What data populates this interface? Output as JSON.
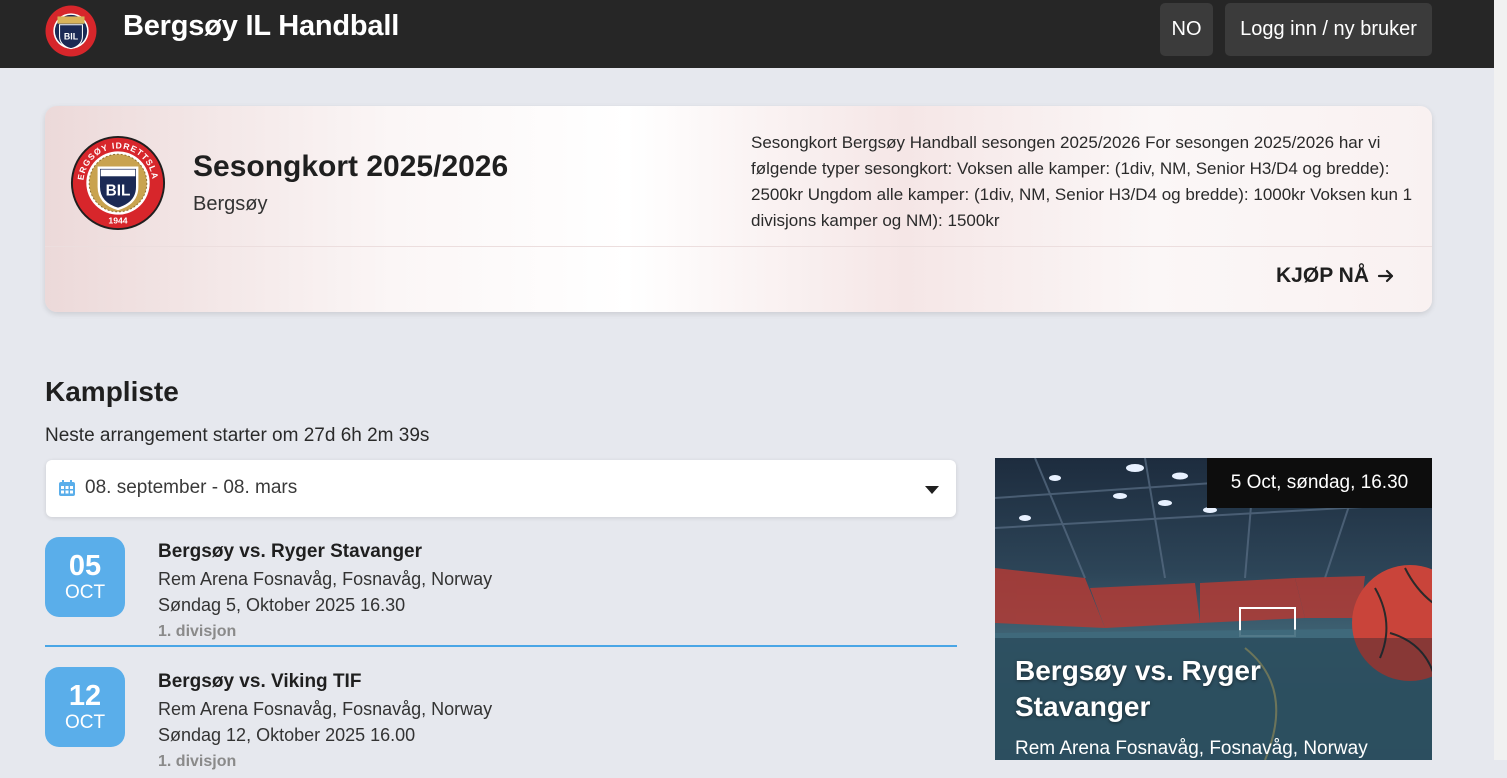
{
  "header": {
    "club_name": "Bergsøy IL Handball",
    "language_label": "NO",
    "login_label": "Logg inn / ny bruker"
  },
  "logo": {
    "ring_text": "BERGSØY IDRETTSLAG",
    "shield_text": "BIL",
    "year": "1944",
    "colors": {
      "ring": "#d7262b",
      "inner": "#1b2a55",
      "gold": "#d8b35a"
    }
  },
  "season_card": {
    "title": "Sesongkort 2025/2026",
    "subtitle": "Bergsøy",
    "description": "Sesongkort Bergsøy Handball sesongen 2025/2026 For sesongen 2025/2026 har vi følgende typer sesongkort: Voksen alle kamper: (1div, NM, Senior H3/D4 og bredde): 2500kr Ungdom alle kamper: (1div, NM, Senior H3/D4 og bredde): 1000kr Voksen kun 1 divisjons kamper og NM): 1500kr",
    "buy_label": "KJØP NÅ",
    "buy_icon": "arrow-right-icon"
  },
  "match_list": {
    "title": "Kampliste",
    "countdown": "Neste arrangement starter om 27d 6h 2m 39s",
    "date_range": "08. september - 08. mars",
    "matches": [
      {
        "day": "05",
        "month": "OCT",
        "teams": "Bergsøy vs. Ryger Stavanger",
        "venue": "Rem Arena Fosnavåg, Fosnavåg, Norway",
        "datetime": "Søndag 5, Oktober 2025 16.30",
        "league": "1. divisjon"
      },
      {
        "day": "12",
        "month": "OCT",
        "teams": "Bergsøy vs. Viking TIF",
        "venue": "Rem Arena Fosnavåg, Fosnavåg, Norway",
        "datetime": "Søndag 12, Oktober 2025 16.00",
        "league": "1. divisjon"
      }
    ]
  },
  "featured": {
    "date_tag": "5 Oct, søndag, 16.30",
    "title": "Bergsøy vs. Ryger Stavanger",
    "venue": "Rem Arena Fosnavåg, Fosnavåg, Norway"
  },
  "colors": {
    "topbar": "#262626",
    "accent_blue": "#5aaeea",
    "page_background": "#e6e8ee"
  }
}
